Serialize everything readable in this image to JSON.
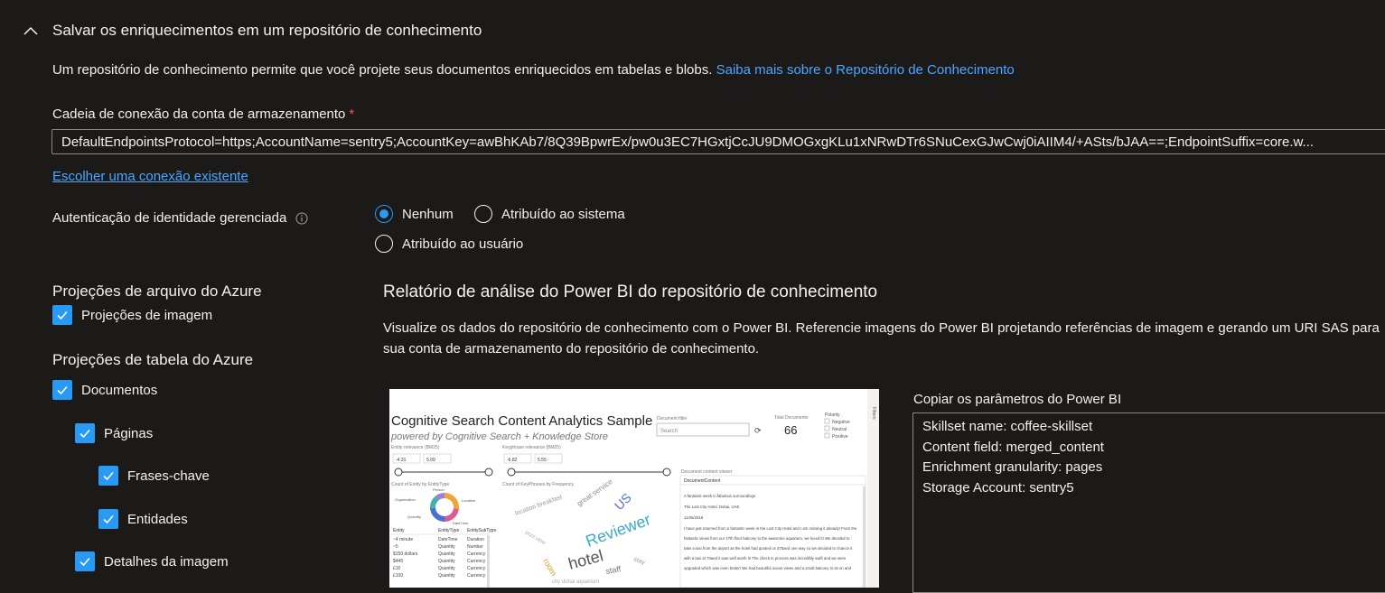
{
  "section": {
    "title": "Salvar os enriquecimentos em um repositório de conhecimento",
    "description": "Um repositório de conhecimento permite que você projete seus documentos enriquecidos em tabelas e blobs.",
    "learn_more_link": "Saiba mais sobre o Repositório de Conhecimento"
  },
  "connection": {
    "label": "Cadeia de conexão da conta de armazenamento",
    "required_marker": "*",
    "value": "DefaultEndpointsProtocol=https;AccountName=sentry5;AccountKey=awBhKAb7/8Q39BpwrEx/pw0u3EC7HGxtjCcJU9DMOGxgKLu1xNRwDTr6SNuCexGJwCwj0iAIIM4/+ASts/bJAA==;EndpointSuffix=core.w...",
    "choose_existing_link": "Escolher uma conexão existente"
  },
  "auth": {
    "label": "Autenticação de identidade gerenciada",
    "options": [
      {
        "label": "Nenhum",
        "selected": true
      },
      {
        "label": "Atribuído ao sistema",
        "selected": false
      },
      {
        "label": "Atribuído ao usuário",
        "selected": false
      }
    ]
  },
  "file_projections": {
    "title": "Projeções de arquivo do Azure",
    "items": [
      {
        "label": "Projeções de imagem",
        "checked": true
      }
    ]
  },
  "table_projections": {
    "title": "Projeções de tabela do Azure",
    "items": [
      {
        "label": "Documentos",
        "checked": true
      },
      {
        "label": "Páginas",
        "checked": true
      },
      {
        "label": "Frases-chave",
        "checked": true
      },
      {
        "label": "Entidades",
        "checked": true
      },
      {
        "label": "Detalhes da imagem",
        "checked": true
      }
    ]
  },
  "powerbi": {
    "title": "Relatório de análise do Power BI do repositório de conhecimento",
    "description": "Visualize os dados do repositório de conhecimento com o Power BI. Referencie imagens do Power BI projetando referências de imagem e gerando um URI SAS para sua conta de armazenamento do repositório de conhecimento.",
    "copy_label": "Copiar os parâmetros do Power BI",
    "params": [
      "Skillset name: coffee-skillset",
      "Content field: merged_content",
      "Enrichment granularity: pages",
      "Storage Account: sentry5"
    ],
    "thumbnail": {
      "title": "Cognitive Search Content Analytics Sample",
      "subtitle": "powered by Cognitive Search + Knowledge Store",
      "doc_filter_label": "Document filter",
      "search_placeholder": "Search",
      "total_docs_label": "Total Documents",
      "total_docs_value": "66",
      "polarity_label": "Polarity",
      "polarity_options": [
        "Negative",
        "Neutral",
        "Positive"
      ],
      "entity_relevance_label": "Entity relevance (BM25)",
      "entity_range": [
        "-4.31",
        "5.09"
      ],
      "keyphrase_relevance_label": "Keyphrase relevance (BM25)",
      "keyphrase_range": [
        "-6.82",
        "5.55"
      ],
      "entity_chart_label": "Count of Entity by EntityType",
      "donut_labels": [
        "Person",
        "Organization",
        "Location",
        "Quantity",
        "DateTime"
      ],
      "keyphrase_chart_label": "Count of KeyPhrases by Frequency",
      "table_headers": [
        "Entity",
        "EntityType",
        "EntitySubType"
      ],
      "table_rows": [
        [
          "~4 minute",
          "DateTime",
          "Duration"
        ],
        [
          "~5",
          "Quantity",
          "Number"
        ],
        [
          "$150 dollars",
          "Quantity",
          "Currency"
        ],
        [
          "$445",
          "Quantity",
          "Currency"
        ],
        [
          "£10",
          "Quantity",
          "Currency"
        ],
        [
          "£100",
          "Quantity",
          "Currency"
        ]
      ],
      "word_cloud": [
        "Reviewer",
        "hotel",
        "room",
        "staff",
        "stay"
      ],
      "doc_content_label": "Document content viewer",
      "doc_content_header": "DocumentContent",
      "doc_content_lines": [
        "A fantastic week in fabulous surroundings",
        "The Lost City Hotel, Dubai, UAE",
        "11/25/2018",
        "I have just returned from a fantastic week in the Lost City Hotel and I am missing it already! From the",
        "fantastic views from our 17th floor balcony to the awesome aquarium, we loved it! We decided to",
        "take a taxi from the airport as the hotel had quoted us 375aed one way so we decided to chance it",
        "with a taxi at 70aed it was well worth it! The check in process was incredibly swift and we were",
        "upgraded which was even better! We had beautiful ocean views and a small balcony to sit on and"
      ],
      "filters_tab": "Filters"
    }
  }
}
